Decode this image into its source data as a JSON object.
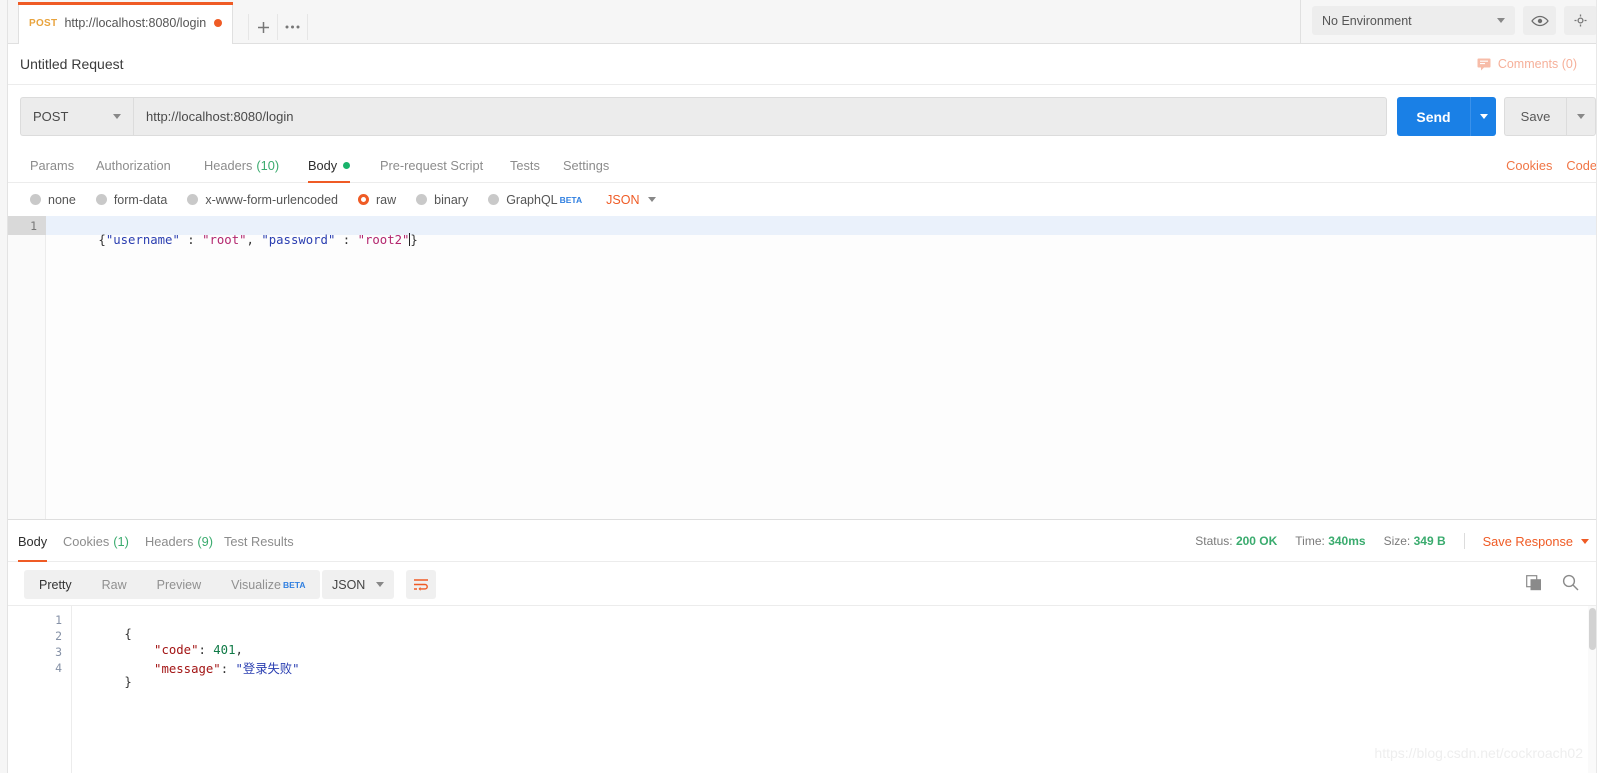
{
  "tab": {
    "method": "POST",
    "url": "http://localhost:8080/login",
    "new_label": "+",
    "more_label": "•••"
  },
  "environment": {
    "selected": "No Environment",
    "eye_icon": "eye-icon",
    "more_icon": "settings-icon"
  },
  "request": {
    "title": "Untitled Request",
    "comments_label": "Comments (0)",
    "method": "POST",
    "url": "http://localhost:8080/login",
    "send_label": "Send",
    "save_label": "Save"
  },
  "request_tabs": [
    {
      "label": "Params",
      "active": false
    },
    {
      "label": "Authorization",
      "active": false
    },
    {
      "label": "Headers",
      "count": "(10)",
      "active": false
    },
    {
      "label": "Body",
      "active": true,
      "dot": true
    },
    {
      "label": "Pre-request Script",
      "active": false
    },
    {
      "label": "Tests",
      "active": false
    },
    {
      "label": "Settings",
      "active": false
    }
  ],
  "request_tabs_right": [
    {
      "label": "Cookies"
    },
    {
      "label": "Code"
    }
  ],
  "body_types": [
    {
      "label": "none",
      "selected": false
    },
    {
      "label": "form-data",
      "selected": false
    },
    {
      "label": "x-www-form-urlencoded",
      "selected": false
    },
    {
      "label": "raw",
      "selected": true
    },
    {
      "label": "binary",
      "selected": false
    },
    {
      "label": "GraphQL",
      "selected": false,
      "badge": "BETA"
    }
  ],
  "body_format": "JSON",
  "request_body": {
    "line_number": "1",
    "segments": [
      {
        "text": "{",
        "type": "pun"
      },
      {
        "text": "\"username\"",
        "type": "key"
      },
      {
        "text": " : ",
        "type": "pun"
      },
      {
        "text": "\"root\"",
        "type": "str"
      },
      {
        "text": ", ",
        "type": "pun"
      },
      {
        "text": "\"password\"",
        "type": "key"
      },
      {
        "text": " : ",
        "type": "pun"
      },
      {
        "text": "\"root2\"",
        "type": "str"
      },
      {
        "text": "}",
        "type": "pun"
      }
    ],
    "raw": "{\"username\" : \"root\", \"password\" : \"root2\"}"
  },
  "response_tabs": [
    {
      "label": "Body",
      "active": true
    },
    {
      "label": "Cookies",
      "count": "(1)",
      "active": false
    },
    {
      "label": "Headers",
      "count": "(9)",
      "active": false
    },
    {
      "label": "Test Results",
      "active": false
    }
  ],
  "response_status": {
    "status_label": "Status:",
    "status_value": "200 OK",
    "time_label": "Time:",
    "time_value": "340ms",
    "size_label": "Size:",
    "size_value": "349 B",
    "save_response_label": "Save Response"
  },
  "response_format_tabs": [
    {
      "label": "Pretty",
      "active": true
    },
    {
      "label": "Raw",
      "active": false
    },
    {
      "label": "Preview",
      "active": false
    },
    {
      "label": "Visualize",
      "active": false,
      "badge": "BETA"
    }
  ],
  "response_format": "JSON",
  "response_icons": {
    "copy": "copy-icon",
    "search": "search-icon",
    "wrap": "word-wrap-icon"
  },
  "response_body": {
    "lines": [
      {
        "n": "1",
        "segments": [
          {
            "text": "{",
            "type": "pun"
          }
        ]
      },
      {
        "n": "2",
        "segments": [
          {
            "text": "    ",
            "type": "pun"
          },
          {
            "text": "\"code\"",
            "type": "key"
          },
          {
            "text": ": ",
            "type": "pun"
          },
          {
            "text": "401",
            "type": "num"
          },
          {
            "text": ",",
            "type": "pun"
          }
        ]
      },
      {
        "n": "3",
        "segments": [
          {
            "text": "    ",
            "type": "pun"
          },
          {
            "text": "\"message\"",
            "type": "key"
          },
          {
            "text": ": ",
            "type": "pun"
          },
          {
            "text": "\"登录失败\"",
            "type": "str"
          }
        ]
      },
      {
        "n": "4",
        "segments": [
          {
            "text": "}",
            "type": "pun"
          }
        ]
      }
    ],
    "raw": "{\n    \"code\": 401,\n    \"message\": \"登录失败\"\n}"
  },
  "watermark": "https://blog.csdn.net/cockroach02",
  "colors": {
    "accent_orange": "#ef5b25",
    "send_blue": "#1a80e6",
    "status_green": "#3aab6e",
    "beta_blue": "#2f7fe0"
  }
}
